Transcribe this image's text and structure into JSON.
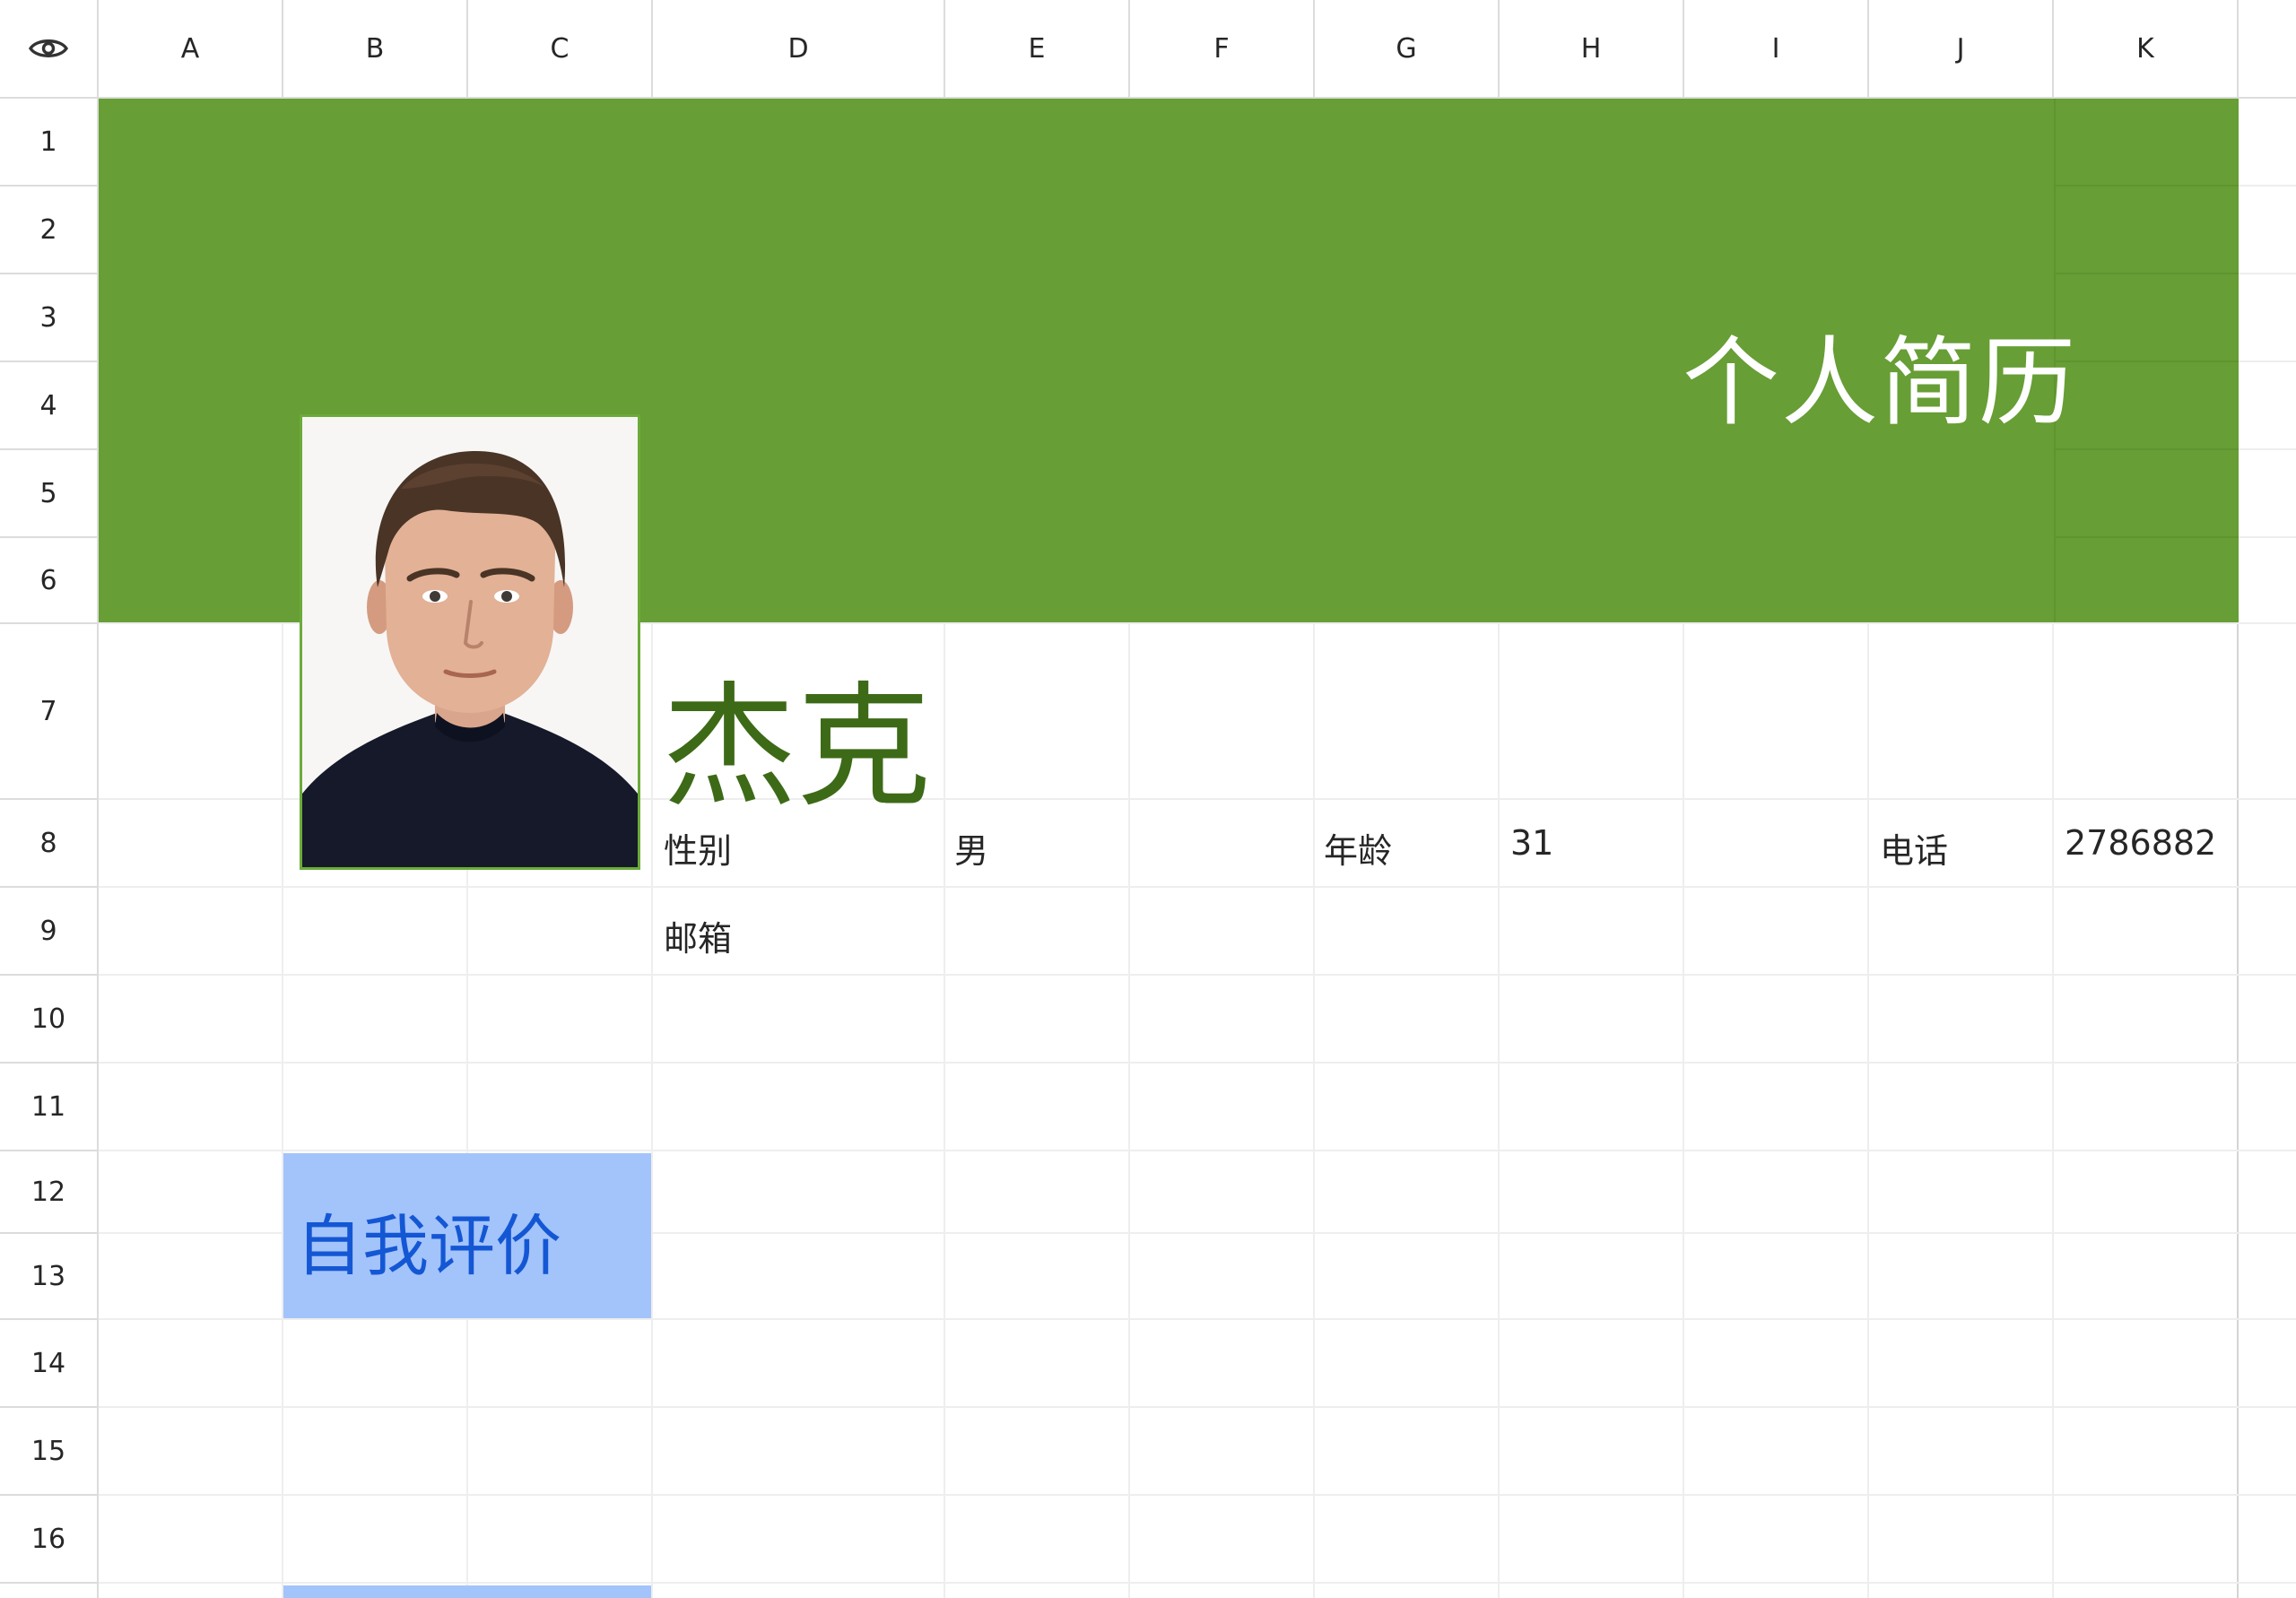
{
  "columns": [
    "A",
    "B",
    "C",
    "D",
    "E",
    "F",
    "G",
    "H",
    "I",
    "J",
    "K"
  ],
  "rows": [
    "1",
    "2",
    "3",
    "4",
    "5",
    "6",
    "7",
    "8",
    "9",
    "10",
    "11",
    "12",
    "13",
    "14",
    "15",
    "16"
  ],
  "header": {
    "icon": "eye-icon"
  },
  "sheet": {
    "title": "个人简历",
    "name": "杰克",
    "gender_label": "性别",
    "gender_value": "男",
    "age_label": "年龄",
    "age_value": "31",
    "phone_label": "电话",
    "phone_value": "2786882",
    "email_label": "邮箱",
    "self_eval": "自我评价"
  },
  "colors": {
    "banner": "#679e35",
    "name": "#3d6a17",
    "eval_bg": "#a3c3fb",
    "eval_text": "#1457d4"
  }
}
